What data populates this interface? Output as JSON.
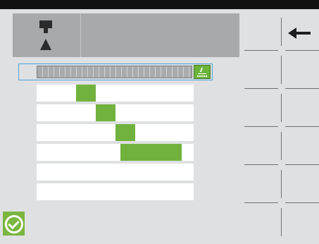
{
  "toolbar": {
    "tool_icon": "tool-icon",
    "back_icon": "back-arrow-icon",
    "confirm_icon": "check-circle-icon"
  },
  "colors": {
    "accent_green": "#71b23f",
    "selection_blue": "#4fa3d9",
    "panel_grey": "#a8a9ab",
    "background": "#dfe0e2"
  },
  "schedule": {
    "ruler_button_icon": "ruler-scale-icon",
    "rows": [
      {
        "bar": {
          "start": 0.25,
          "end": 0.375
        }
      },
      {
        "bar": {
          "start": 0.375,
          "end": 0.5
        }
      },
      {
        "bar": {
          "start": 0.5,
          "end": 0.625
        }
      },
      {
        "bar": {
          "start": 0.535,
          "end": 0.925
        }
      },
      {
        "bar": null
      },
      {
        "bar": null
      }
    ]
  }
}
